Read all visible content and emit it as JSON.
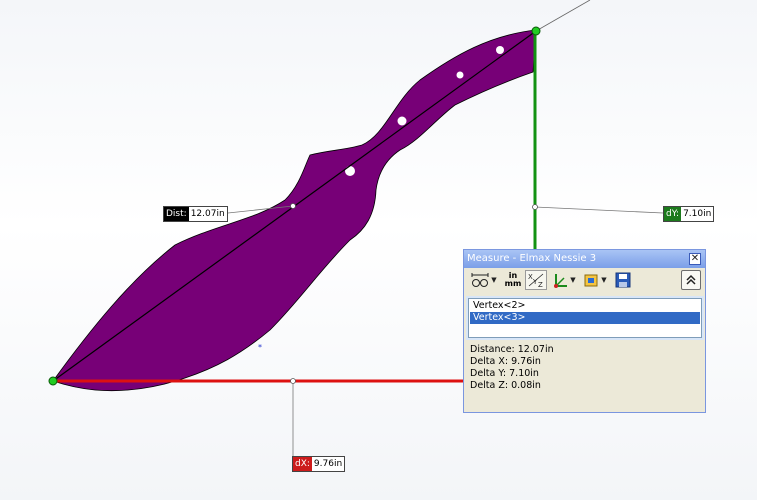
{
  "measure": {
    "title": "Measure - Elmax Nessie 3",
    "close_icon": "close-icon",
    "toolbar": {
      "arc_circle_icon": "arc-circle-measurement-icon",
      "units_top": "in",
      "units_bottom": "mm",
      "units_icon": "units-precision-icon",
      "xyz_icon": "show-xyz-measurements-icon",
      "point_to_point_icon": "point-to-point-icon",
      "projection_icon": "projection-icon",
      "history_icon": "measurement-history-icon",
      "save_icon": "save-icon",
      "collapse_icon": "collapse-chevron-icon"
    },
    "selections": [
      "Vertex<2>",
      "Vertex<3>"
    ],
    "selected_index": 1,
    "results": {
      "distance": "Distance: 12.07in",
      "delta_x": "Delta X: 9.76in",
      "delta_y": "Delta Y: 7.10in",
      "delta_z": "Delta Z: 0.08in"
    }
  },
  "callouts": {
    "dist": {
      "label": "Dist:",
      "value": "12.07in",
      "color": "#000000"
    },
    "dy": {
      "label": "dY:",
      "value": "7.10in",
      "color": "#1c7a1c"
    },
    "dx": {
      "label": "dX:",
      "value": "9.76in",
      "color": "#cc1b1b"
    }
  },
  "colors": {
    "part": "#770077",
    "x_axis": "#dd1111",
    "y_axis": "#129212",
    "vertex": "#22cc22",
    "panel_bg": "#ece9d8",
    "selection": "#316ac5"
  }
}
